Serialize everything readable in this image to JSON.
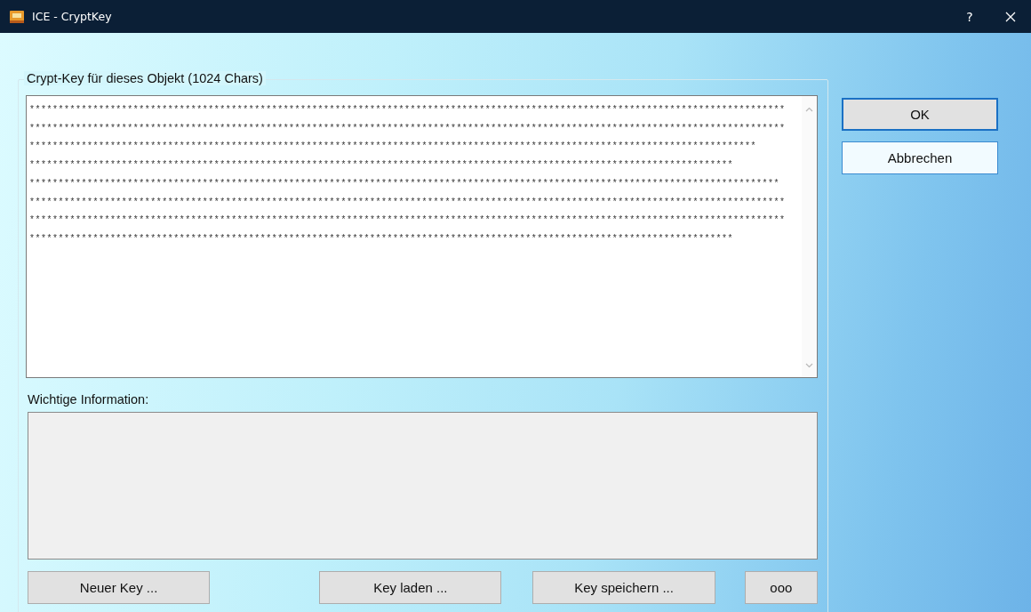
{
  "window": {
    "title": "ICE - CryptKey",
    "help_button": "?"
  },
  "key_group": {
    "label": "Crypt-Key für dieses Objekt (1024 Chars)",
    "key_text": "***********************************************************************************************************************************\n***********************************************************************************************************************************\n******************************************************************************************************************************\n**************************************************************************************************************************\n**********************************************************************************************************************************\n***********************************************************************************************************************************\n***********************************************************************************************************************************\n**************************************************************************************************************************",
    "info_label": "Wichtige Information:",
    "buttons": [
      "Neuer Key ...",
      "Key laden ...",
      "Key speichern ...",
      "ooo"
    ]
  },
  "dialog_buttons": [
    {
      "label": "OK",
      "default": true
    },
    {
      "label": "Abbrechen",
      "default": false
    }
  ]
}
